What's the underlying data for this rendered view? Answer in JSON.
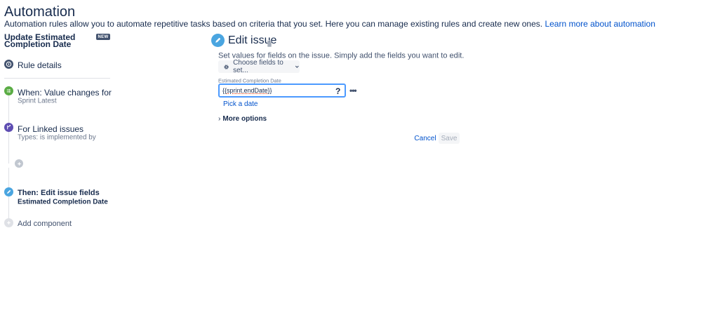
{
  "header": {
    "title": "Automation",
    "description": "Automation rules allow you to automate repetitive tasks based on criteria that you set. Here you can manage existing rules and create new ones.",
    "learn_more": "Learn more about automation"
  },
  "rule": {
    "name": "Update Estimated Completion Date",
    "badge": "NEW",
    "details_label": "Rule details",
    "trigger": {
      "title": "When: Value changes for",
      "subtitle": "Sprint Latest"
    },
    "branch": {
      "title": "For Linked issues",
      "subtitle": "Types: is implemented by"
    },
    "action": {
      "title": "Then: Edit issue fields",
      "subtitle": "Estimated Completion Date"
    },
    "add_component": "Add component"
  },
  "panel": {
    "title": "Edit issue",
    "description": "Set values for fields on the issue. Simply add the fields you want to edit.",
    "choose_fields": "Choose fields to set...",
    "field_label": "Estimated Completion Date",
    "field_value": "{{sprint.endDate}}",
    "help": "?",
    "more": "•••",
    "pick_date": "Pick a date",
    "more_options": "More options",
    "cancel": "Cancel",
    "save": "Save"
  },
  "colors": {
    "accent": "#0052cc",
    "edit_icon": "#4aa5e0",
    "trigger_icon": "#5aac44",
    "branch_icon": "#5e4db2",
    "details_icon": "#42526e"
  },
  "icons": {
    "rule_details": "info-icon",
    "trigger": "trigger-icon",
    "branch": "branch-icon",
    "add": "plus-icon",
    "action": "pencil-icon",
    "add_component": "plus-icon",
    "trash": "trash-icon",
    "settings": "gear-icon"
  }
}
